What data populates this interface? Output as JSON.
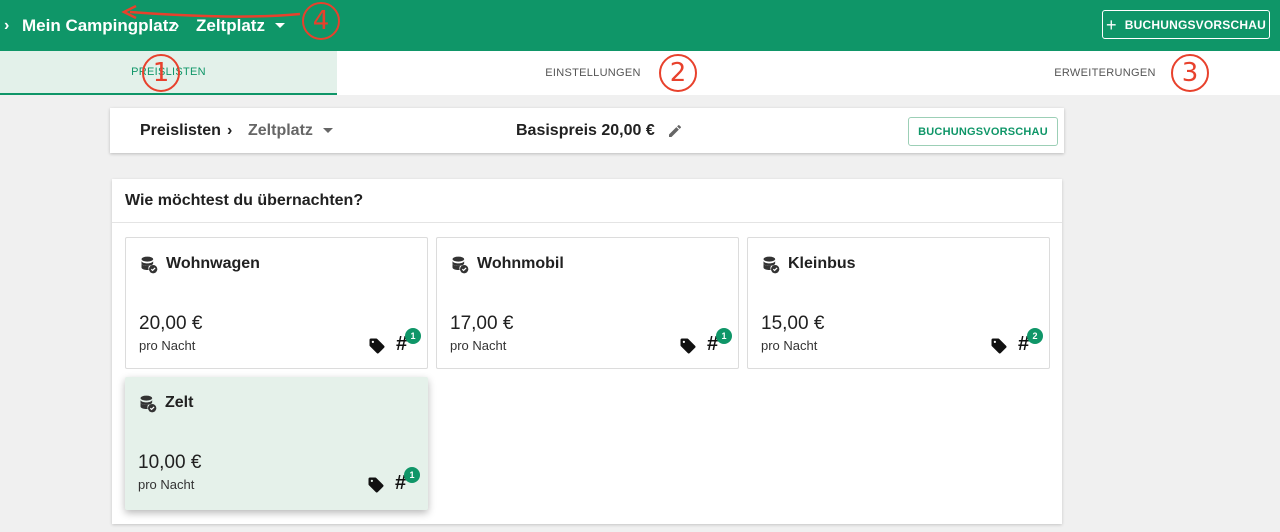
{
  "topbar": {
    "crumb_root": "Mein Campingplatz",
    "crumb_current": "Zeltplatz",
    "preview_button": "BUCHUNGSVORSCHAU"
  },
  "tabs": [
    {
      "label": "PREISLISTEN",
      "active": true
    },
    {
      "label": "EINSTELLUNGEN",
      "active": false
    },
    {
      "label": "ERWEITERUNGEN",
      "active": false
    }
  ],
  "header": {
    "crumb_root": "Preislisten",
    "crumb_current": "Zeltplatz",
    "base_price": "Basispreis 20,00 €",
    "preview_button": "BUCHUNGSVORSCHAU"
  },
  "main": {
    "title": "Wie möchtest du übernachten?",
    "items": [
      {
        "name": "Wohnwagen",
        "price": "20,00 €",
        "unit": "pro Nacht",
        "count": "1",
        "selected": false
      },
      {
        "name": "Wohnmobil",
        "price": "17,00 €",
        "unit": "pro Nacht",
        "count": "1",
        "selected": false
      },
      {
        "name": "Kleinbus",
        "price": "15,00 €",
        "unit": "pro Nacht",
        "count": "2",
        "selected": false
      },
      {
        "name": "Zelt",
        "price": "10,00 €",
        "unit": "pro Nacht",
        "count": "1",
        "selected": true
      }
    ]
  },
  "annotations": [
    "1",
    "2",
    "3",
    "4"
  ],
  "colors": {
    "accent": "#0f9668",
    "annotation": "#e8412c"
  }
}
